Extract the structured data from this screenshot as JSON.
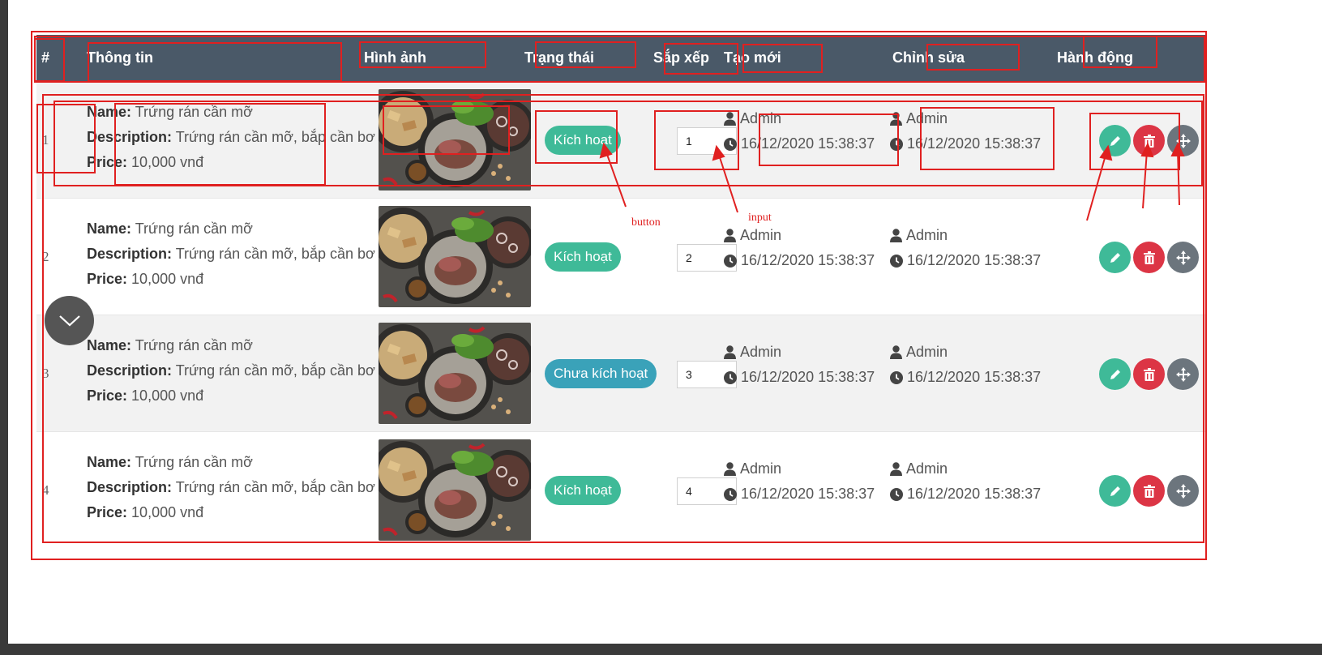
{
  "table": {
    "headers": {
      "index": "#",
      "info": "Thông tin",
      "image": "Hình ảnh",
      "status": "Trạng thái",
      "order": "Sắp xếp",
      "created": "Tạo mới",
      "modified": "Chỉnh sửa",
      "actions": "Hành động"
    },
    "field_labels": {
      "name": "Name:",
      "description": "Description:",
      "price": "Price:"
    },
    "rows": [
      {
        "index": "1",
        "name": "Trứng rán cần mỡ",
        "description": "Trứng rán cần mỡ, bắp cần bơ",
        "price": "10,000 vnđ",
        "status": "Kích hoạt",
        "status_state": "active",
        "order": "1",
        "created_by": "Admin",
        "created_at": "16/12/2020 15:38:37",
        "modified_by": "Admin",
        "modified_at": "16/12/2020 15:38:37"
      },
      {
        "index": "2",
        "name": "Trứng rán cần mỡ",
        "description": "Trứng rán cần mỡ, bắp cần bơ",
        "price": "10,000 vnđ",
        "status": "Kích hoạt",
        "status_state": "active",
        "order": "2",
        "created_by": "Admin",
        "created_at": "16/12/2020 15:38:37",
        "modified_by": "Admin",
        "modified_at": "16/12/2020 15:38:37"
      },
      {
        "index": "3",
        "name": "Trứng rán cần mỡ",
        "description": "Trứng rán cần mỡ, bắp cần bơ",
        "price": "10,000 vnđ",
        "status": "Chưa kích hoạt",
        "status_state": "inactive",
        "order": "3",
        "created_by": "Admin",
        "created_at": "16/12/2020 15:38:37",
        "modified_by": "Admin",
        "modified_at": "16/12/2020 15:38:37"
      },
      {
        "index": "4",
        "name": "Trứng rán cần mỡ",
        "description": "Trứng rán cần mỡ, bắp cần bơ",
        "price": "10,000 vnđ",
        "status": "Kích hoạt",
        "status_state": "active",
        "order": "4",
        "created_by": "Admin",
        "created_at": "16/12/2020 15:38:37",
        "modified_by": "Admin",
        "modified_at": "16/12/2020 15:38:37"
      }
    ]
  },
  "annotations": {
    "button_label": "button",
    "input_label": "input"
  },
  "icons": {
    "user": "user-icon",
    "clock": "clock-icon",
    "edit": "pencil-icon",
    "delete": "trash-icon",
    "move": "move-icon",
    "scroll": "chevron-down-icon"
  },
  "colors": {
    "header_bg": "#4a5968",
    "active": "#3fba98",
    "inactive": "#3aa2b9",
    "delete": "#dc3545",
    "move": "#6c757d",
    "annotation": "#e02020"
  }
}
